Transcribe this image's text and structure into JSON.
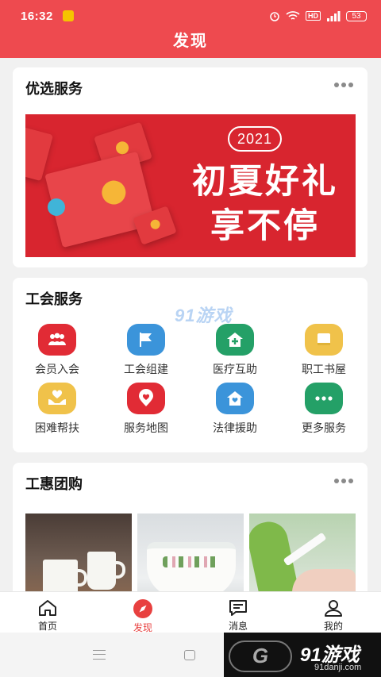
{
  "status_bar": {
    "time": "16:32",
    "hd_label": "HD",
    "battery": "53"
  },
  "header": {
    "title": "发现"
  },
  "featured": {
    "title": "优选服务",
    "banner": {
      "year": "2021",
      "line1": "初夏好礼",
      "line2": "享不停"
    }
  },
  "union_services": {
    "title": "工会服务",
    "watermark": "91游戏",
    "items": [
      {
        "label": "会员入会",
        "icon": "people-group-icon",
        "color": "#e12b35"
      },
      {
        "label": "工会组建",
        "icon": "flag-icon",
        "color": "#3b94da"
      },
      {
        "label": "医疗互助",
        "icon": "medical-house-icon",
        "color": "#24a067"
      },
      {
        "label": "职工书屋",
        "icon": "book-icon",
        "color": "#f0c24a"
      },
      {
        "label": "困难帮扶",
        "icon": "hands-heart-icon",
        "color": "#f0c24a"
      },
      {
        "label": "服务地图",
        "icon": "map-pin-heart-icon",
        "color": "#e12b35"
      },
      {
        "label": "法律援助",
        "icon": "legal-house-icon",
        "color": "#3b94da"
      },
      {
        "label": "更多服务",
        "icon": "more-icon",
        "color": "#24a067"
      }
    ]
  },
  "group_buy": {
    "title": "工惠团购"
  },
  "tab_bar": {
    "items": [
      {
        "label": "首页",
        "icon": "home-icon"
      },
      {
        "label": "发现",
        "icon": "compass-icon",
        "active": true
      },
      {
        "label": "消息",
        "icon": "message-icon"
      },
      {
        "label": "我的",
        "icon": "user-icon"
      }
    ]
  },
  "watermark": {
    "text": "91游戏",
    "url": "91danji.com"
  }
}
